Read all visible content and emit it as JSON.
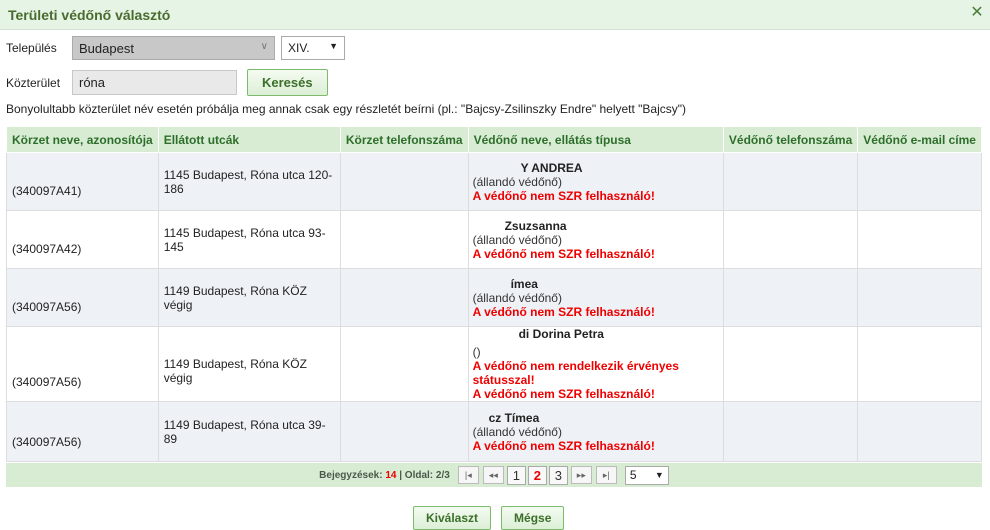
{
  "dialog": {
    "title": "Területi védőnő választó",
    "close_symbol": "✕"
  },
  "form": {
    "settlement_label": "Település",
    "settlement_value": "Budapest",
    "district_value": "XIV.",
    "street_label": "Közterület",
    "street_value": "róna",
    "search_label": "Keresés",
    "hint": "Bonyolultabb közterület név esetén próbálja meg annak csak egy részletét beírni (pl.: \"Bajcsy-Zsilinszky Endre\" helyett \"Bajcsy\")"
  },
  "table": {
    "headers": [
      "Körzet neve, azonosítója",
      "Ellátott utcák",
      "Körzet telefonszáma",
      "Védőnő neve, ellátás típusa",
      "Védőnő telefonszáma",
      "Védőnő e-mail címe"
    ],
    "rows": [
      {
        "id": "(340097A41)",
        "street": "1145 Budapest, Róna utca 120-186",
        "phone": "",
        "name": "Y ANDREA",
        "type": "(állandó védőnő)",
        "warnings": [
          "A védőnő nem SZR felhasználó!"
        ],
        "v_phone": "",
        "email": ""
      },
      {
        "id": "(340097A42)",
        "street": "1145 Budapest, Róna utca 93-145",
        "phone": "",
        "name": "Zsuzsanna",
        "type": "(állandó védőnő)",
        "warnings": [
          "A védőnő nem SZR felhasználó!"
        ],
        "v_phone": "",
        "email": ""
      },
      {
        "id": "(340097A56)",
        "street": "1149 Budapest, Róna KÖZ végig",
        "phone": "",
        "name": "ímea",
        "type": "(állandó védőnő)",
        "warnings": [
          "A védőnő nem SZR felhasználó!"
        ],
        "v_phone": "",
        "email": ""
      },
      {
        "id": "(340097A56)",
        "street": "1149 Budapest, Róna KÖZ végig",
        "phone": "",
        "name": "di Dorina Petra",
        "type": "()",
        "warnings": [
          "A védőnő nem rendelkezik érvényes státusszal!",
          "A védőnő nem SZR felhasználó!"
        ],
        "v_phone": "",
        "email": ""
      },
      {
        "id": "(340097A56)",
        "street": "1149 Budapest, Róna utca 39-89",
        "phone": "",
        "name": "cz Tímea",
        "type": "(állandó védőnő)",
        "warnings": [
          "A védőnő nem SZR felhasználó!"
        ],
        "v_phone": "",
        "email": ""
      }
    ]
  },
  "pager": {
    "records_label": "Bejegyzések:",
    "records_count": "14",
    "page_label": "| Oldal:",
    "page_info": "2/3",
    "first": "|◂",
    "prev": "◂◂",
    "next": "▸▸",
    "last": "▸|",
    "pages": [
      "1",
      "2",
      "3"
    ],
    "active_page": "2",
    "page_size": "5"
  },
  "footer": {
    "select_label": "Kiválaszt",
    "cancel_label": "Mégse"
  }
}
